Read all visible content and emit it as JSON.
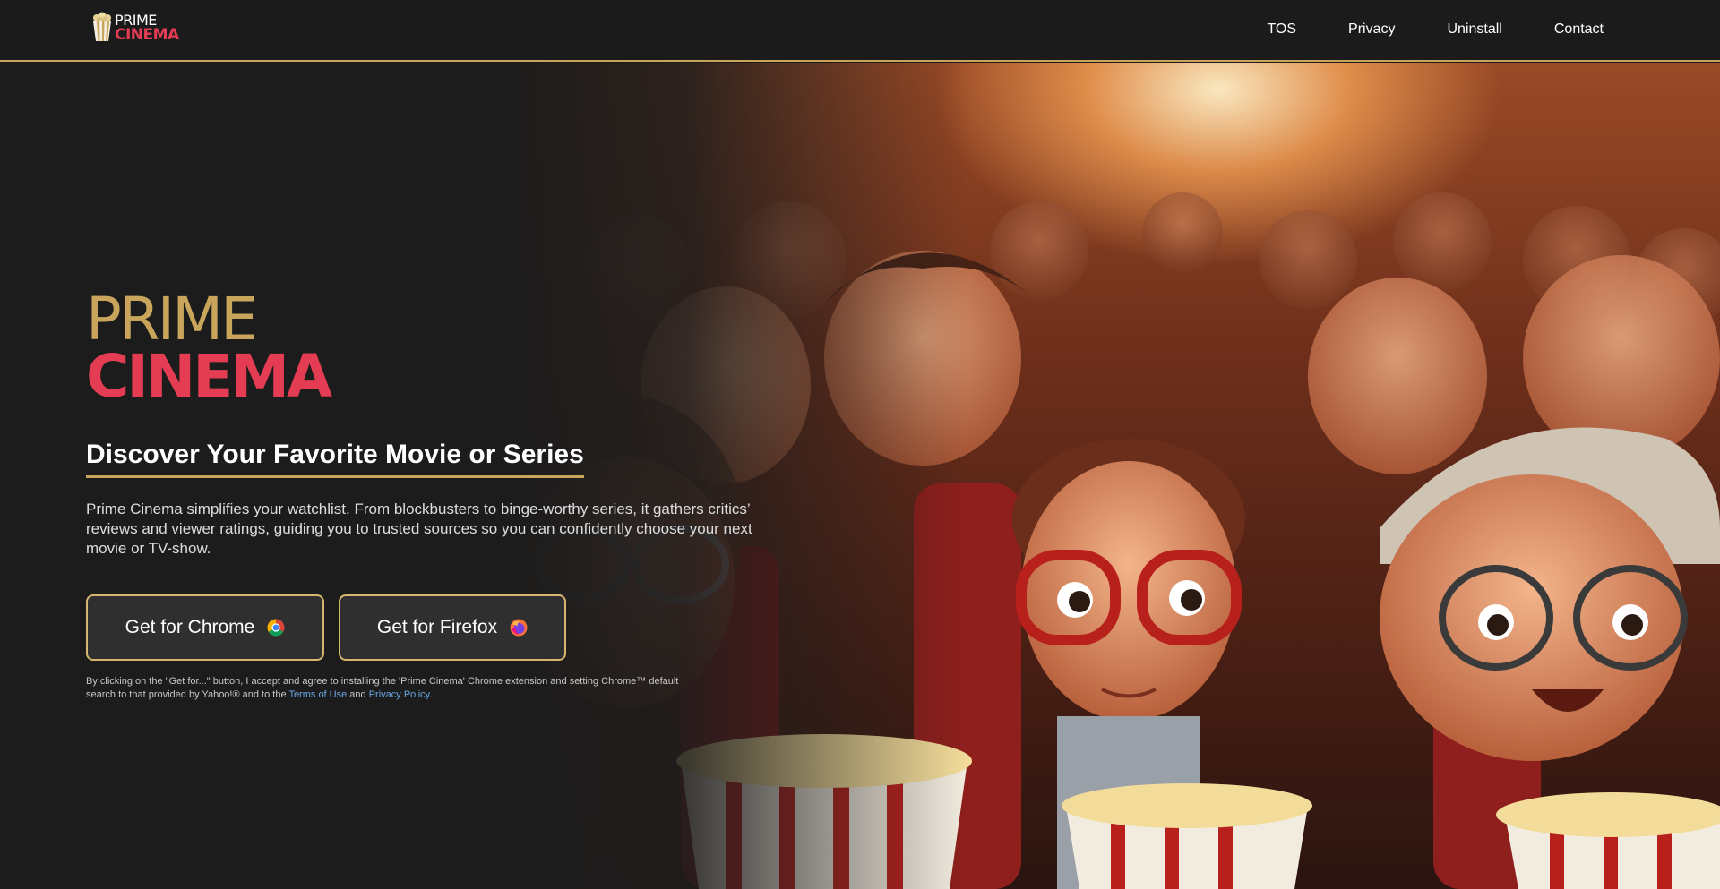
{
  "header": {
    "logo_prime": "PRIME",
    "logo_cinema": "CINEMA",
    "nav": [
      {
        "label": "TOS"
      },
      {
        "label": "Privacy"
      },
      {
        "label": "Uninstall"
      },
      {
        "label": "Contact"
      }
    ]
  },
  "hero": {
    "brand_prime": "PRIME",
    "brand_cinema": "CINEMA",
    "headline": "Discover Your Favorite Movie or Series",
    "description": "Prime Cinema simplifies your watchlist. From blockbusters to binge-worthy series, it gathers critics’ reviews and viewer ratings, guiding you to trusted sources so you can confidently choose your next movie or TV-show.",
    "buttons": {
      "chrome_label": "Get for Chrome",
      "chrome_icon": "chrome-icon",
      "firefox_label": "Get for Firefox",
      "firefox_icon": "firefox-icon"
    },
    "disclaimer": {
      "text": "By clicking on the \"Get for...\" button, I accept and agree to installing the 'Prime Cinema' Chrome extension and setting Chrome™ default search to that provided by Yahoo!® and to the",
      "terms_link": "Terms of Use",
      "and": "and",
      "privacy_link": "Privacy Policy",
      "end": "."
    }
  },
  "colors": {
    "background": "#1c1c1c",
    "gold": "#c9a55c",
    "red": "#e43c52",
    "link": "#6aa6e6"
  }
}
